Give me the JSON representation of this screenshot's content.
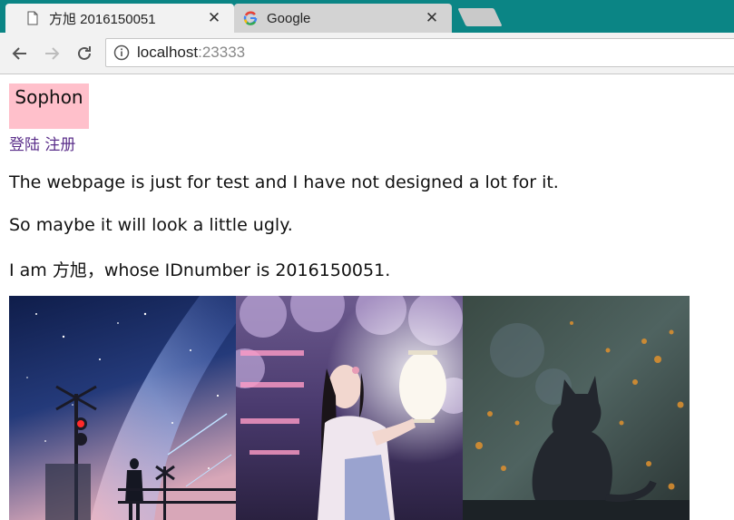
{
  "browser": {
    "tabs": [
      {
        "title": "方旭 2016150051",
        "icon": "page-icon",
        "active": true
      },
      {
        "title": "Google",
        "icon": "google-icon",
        "active": false
      }
    ],
    "close_glyph": "✕",
    "address": {
      "host": "localhost",
      "port": ":23333"
    }
  },
  "page": {
    "brand": "Sophon",
    "nav": {
      "login": "登陆",
      "register": "注册"
    },
    "paragraphs": [
      "The webpage is just for test and I have not designed a lot for it.",
      "So maybe it will look a little ugly.",
      "I am 方旭，whose IDnumber is 2016150051."
    ],
    "gallery": [
      {
        "subject": "starry-sky-railway-crossing"
      },
      {
        "subject": "girl-with-lantern-cherry-blossoms"
      },
      {
        "subject": "cat-silhouette-at-window"
      }
    ]
  },
  "colors": {
    "tabstrip": "#0b8585",
    "brand_bg": "#ffc0cb",
    "link": "#5a2e8a"
  }
}
